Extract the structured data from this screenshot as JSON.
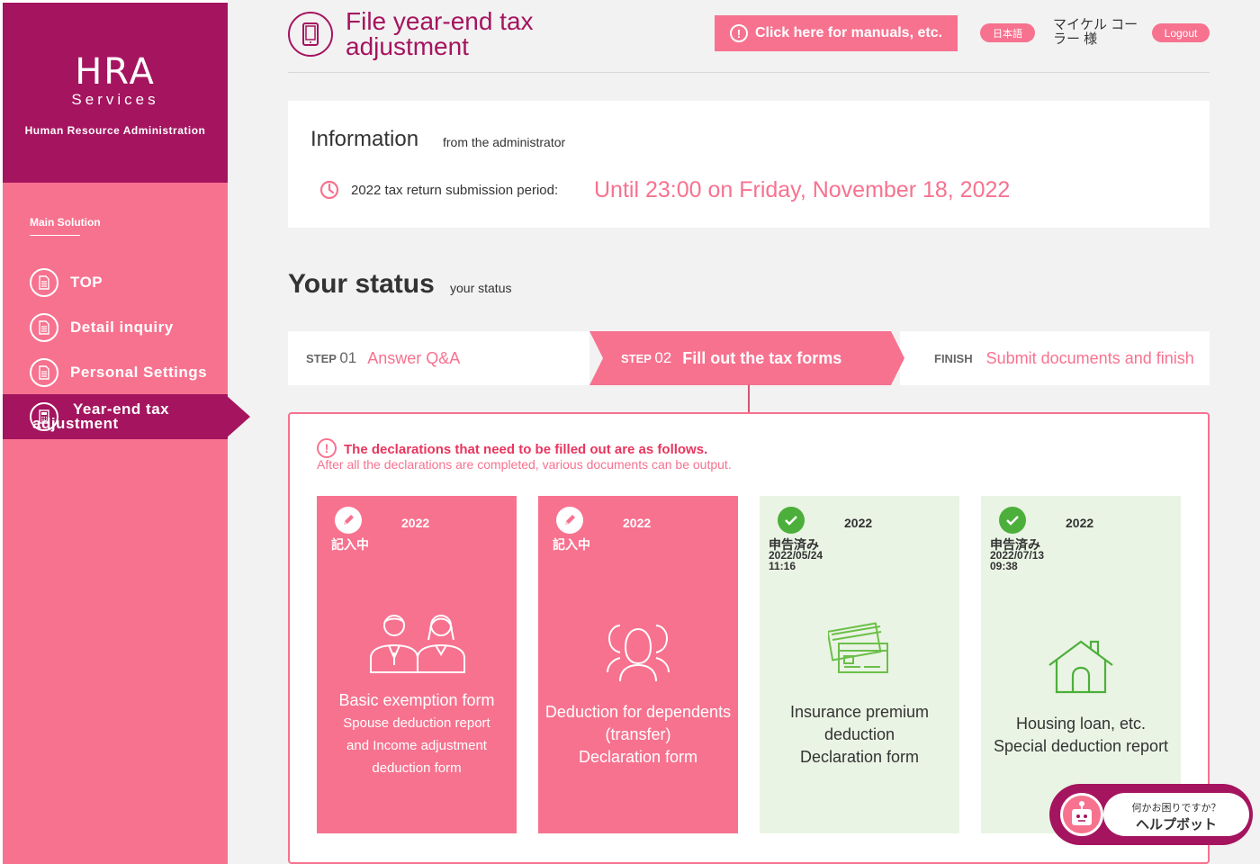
{
  "sidebar": {
    "logo_main": "HRA",
    "logo_sub": "Services",
    "logo_tagline": "Human Resource Administration",
    "section_label": "Main Solution",
    "items": [
      {
        "label": "TOP",
        "icon": "document-icon"
      },
      {
        "label": "Detail inquiry",
        "icon": "document-icon"
      },
      {
        "label": "Personal Settings",
        "icon": "document-icon"
      },
      {
        "label": "Year-end tax adjustment",
        "icon": "calculator-icon",
        "active": true
      }
    ]
  },
  "header": {
    "title": "File year-end tax adjustment",
    "manual_button": "Click here for manuals, etc.",
    "lang_button": "日本語",
    "user_name": "マイケル コーラー 様",
    "logout_button": "Logout"
  },
  "info": {
    "title": "Information",
    "subtitle": "from the administrator",
    "label": "2022 tax return submission period:",
    "deadline": "Until 23:00 on Friday, November 18, 2022"
  },
  "status": {
    "title": "Your status",
    "subtitle": "your status",
    "steps": [
      {
        "prefix": "STEP",
        "num": "01",
        "label": "Answer Q&A"
      },
      {
        "prefix": "STEP",
        "num": "02",
        "label": "Fill out the tax forms",
        "current": true
      },
      {
        "prefix": "FINISH",
        "num": "",
        "label": "Submit documents and finish"
      }
    ]
  },
  "forms": {
    "notice_main": "The declarations that need to be filled out are as follows.",
    "notice_sub": "After all the declarations are completed, various documents can be output.",
    "cards": [
      {
        "year": "2022",
        "status": "記入中",
        "date": "",
        "time": "",
        "title": "Basic exemption form",
        "subtitle_1": "Spouse deduction report",
        "subtitle_2": "and Income adjustment",
        "subtitle_3": "deduction form",
        "state": "in-progress"
      },
      {
        "year": "2022",
        "status": "記入中",
        "date": "",
        "time": "",
        "title_1": "Deduction for dependents",
        "title_2": "(transfer)",
        "title_3": "Declaration form",
        "state": "in-progress"
      },
      {
        "year": "2022",
        "status": "申告済み",
        "date": "2022/05/24",
        "time": "11:16",
        "title_1": "Insurance premium",
        "title_2": "deduction",
        "title_3": "Declaration form",
        "state": "done"
      },
      {
        "year": "2022",
        "status": "申告済み",
        "date": "2022/07/13",
        "time": "09:38",
        "title_1": "Housing loan, etc.",
        "title_2": "Special deduction report",
        "state": "done"
      }
    ]
  },
  "helpbot": {
    "question": "何かお困りですか？",
    "name": "ヘルプボット"
  },
  "colors": {
    "brand": "#a5145f",
    "accent": "#f7728f",
    "done_bg": "#eaf4e4",
    "done_icon": "#4caf3b"
  }
}
